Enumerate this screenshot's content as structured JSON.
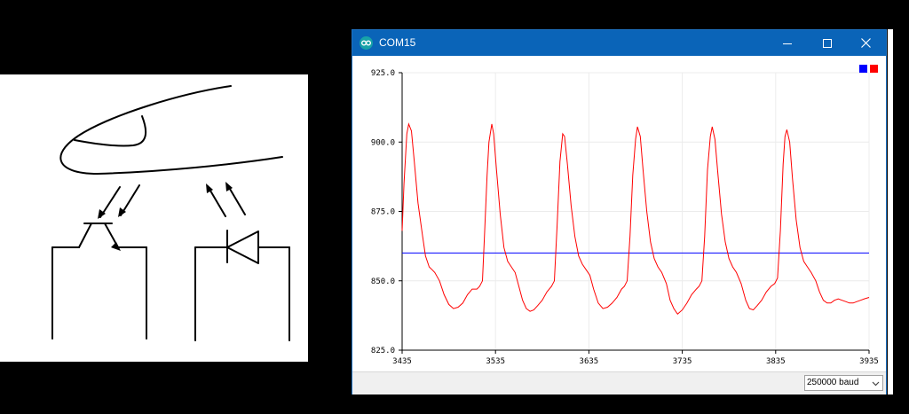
{
  "window": {
    "title": "COM15"
  },
  "icons": {
    "app": "arduino-icon",
    "minimize": "minimize-icon",
    "maximize": "maximize-icon",
    "close": "close-icon",
    "dropdown": "chevron-down-icon"
  },
  "statusbar": {
    "baud": "250000 baud"
  },
  "chart_data": {
    "type": "line",
    "xlim": [
      3435,
      3935
    ],
    "ylim": [
      825.0,
      925.0
    ],
    "x_ticks": [
      3435,
      3535,
      3635,
      3735,
      3835,
      3935
    ],
    "y_ticks": [
      "825.0",
      "850.0",
      "875.0",
      "900.0",
      "925.0"
    ],
    "grid": true,
    "legend": "top-right",
    "series": [
      {
        "color": "#0000ff",
        "values": [
          [
            3435,
            860
          ],
          [
            3935,
            860
          ]
        ]
      },
      {
        "color": "#ff0000",
        "values": [
          [
            3435,
            868
          ],
          [
            3437,
            885
          ],
          [
            3440,
            903
          ],
          [
            3442,
            906.5
          ],
          [
            3445,
            904
          ],
          [
            3448,
            893
          ],
          [
            3452,
            878
          ],
          [
            3457,
            866
          ],
          [
            3460,
            859
          ],
          [
            3464,
            855
          ],
          [
            3467,
            854
          ],
          [
            3470,
            853
          ],
          [
            3475,
            850
          ],
          [
            3480,
            845
          ],
          [
            3485,
            841.5
          ],
          [
            3490,
            840
          ],
          [
            3495,
            840.5
          ],
          [
            3500,
            842
          ],
          [
            3505,
            845
          ],
          [
            3510,
            847
          ],
          [
            3515,
            847
          ],
          [
            3518,
            848
          ],
          [
            3521,
            850
          ],
          [
            3523,
            865
          ],
          [
            3526,
            888
          ],
          [
            3528,
            900
          ],
          [
            3531,
            906.5
          ],
          [
            3533,
            903
          ],
          [
            3536,
            890
          ],
          [
            3540,
            874
          ],
          [
            3544,
            862
          ],
          [
            3548,
            857
          ],
          [
            3552,
            855
          ],
          [
            3556,
            853
          ],
          [
            3560,
            848
          ],
          [
            3564,
            843
          ],
          [
            3568,
            840
          ],
          [
            3572,
            839
          ],
          [
            3576,
            839.5
          ],
          [
            3580,
            841
          ],
          [
            3585,
            843
          ],
          [
            3590,
            846
          ],
          [
            3595,
            848
          ],
          [
            3598,
            850
          ],
          [
            3601,
            870
          ],
          [
            3604,
            893
          ],
          [
            3607,
            903
          ],
          [
            3609,
            902
          ],
          [
            3612,
            892
          ],
          [
            3616,
            877
          ],
          [
            3620,
            866
          ],
          [
            3624,
            859
          ],
          [
            3628,
            856
          ],
          [
            3632,
            854
          ],
          [
            3636,
            852
          ],
          [
            3640,
            847
          ],
          [
            3645,
            842
          ],
          [
            3650,
            840
          ],
          [
            3655,
            840.5
          ],
          [
            3660,
            842
          ],
          [
            3665,
            844
          ],
          [
            3670,
            847
          ],
          [
            3673,
            848
          ],
          [
            3676,
            850
          ],
          [
            3679,
            866
          ],
          [
            3682,
            888
          ],
          [
            3685,
            901
          ],
          [
            3687,
            905.5
          ],
          [
            3690,
            902
          ],
          [
            3693,
            890
          ],
          [
            3697,
            875
          ],
          [
            3701,
            864
          ],
          [
            3705,
            858
          ],
          [
            3709,
            855
          ],
          [
            3713,
            853
          ],
          [
            3718,
            849
          ],
          [
            3722,
            843
          ],
          [
            3726,
            840
          ],
          [
            3730,
            838
          ],
          [
            3735,
            839.5
          ],
          [
            3740,
            842
          ],
          [
            3745,
            845
          ],
          [
            3750,
            847
          ],
          [
            3753,
            848
          ],
          [
            3756,
            850
          ],
          [
            3759,
            866
          ],
          [
            3762,
            890
          ],
          [
            3765,
            902
          ],
          [
            3767,
            905.5
          ],
          [
            3770,
            901
          ],
          [
            3773,
            889
          ],
          [
            3777,
            874
          ],
          [
            3781,
            864
          ],
          [
            3785,
            858
          ],
          [
            3789,
            855
          ],
          [
            3793,
            853
          ],
          [
            3798,
            849
          ],
          [
            3803,
            843
          ],
          [
            3807,
            840
          ],
          [
            3811,
            839.5
          ],
          [
            3815,
            841
          ],
          [
            3820,
            843
          ],
          [
            3825,
            846
          ],
          [
            3830,
            848
          ],
          [
            3834,
            849
          ],
          [
            3837,
            851
          ],
          [
            3840,
            868
          ],
          [
            3843,
            892
          ],
          [
            3845,
            902
          ],
          [
            3847,
            904.5
          ],
          [
            3850,
            900
          ],
          [
            3853,
            887
          ],
          [
            3857,
            872
          ],
          [
            3861,
            862
          ],
          [
            3865,
            857
          ],
          [
            3869,
            855
          ],
          [
            3873,
            853
          ],
          [
            3878,
            850
          ],
          [
            3882,
            846
          ],
          [
            3886,
            843
          ],
          [
            3890,
            842
          ],
          [
            3894,
            842
          ],
          [
            3898,
            843
          ],
          [
            3902,
            843.5
          ],
          [
            3906,
            843
          ],
          [
            3910,
            842.5
          ],
          [
            3914,
            842
          ],
          [
            3918,
            842
          ],
          [
            3922,
            842.5
          ],
          [
            3926,
            843
          ],
          [
            3930,
            843.5
          ],
          [
            3935,
            844
          ]
        ]
      }
    ]
  }
}
